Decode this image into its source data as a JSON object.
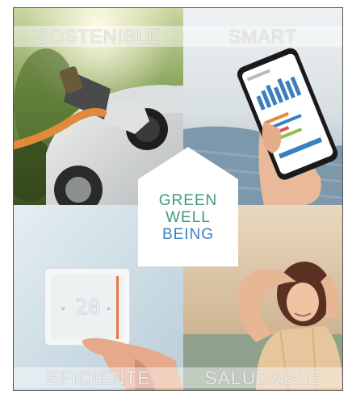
{
  "panels": {
    "top_left": {
      "label": "SOSTENIBLE",
      "image": "electric-car-charging-photo"
    },
    "top_right": {
      "label": "SMART",
      "image": "smartphone-app-photo"
    },
    "bottom_left": {
      "label": "EFICIENTE",
      "image": "thermostat-photo",
      "thermostat_reading": "20"
    },
    "bottom_right": {
      "label": "SALUDABLE",
      "image": "relaxed-woman-photo"
    }
  },
  "center": {
    "line1": "GREEN",
    "line2": "WELL",
    "line3": "BEING"
  },
  "colors": {
    "green": "#3e9a78",
    "blue": "#3b7fbf",
    "charging_cable": "#e08a3c"
  }
}
